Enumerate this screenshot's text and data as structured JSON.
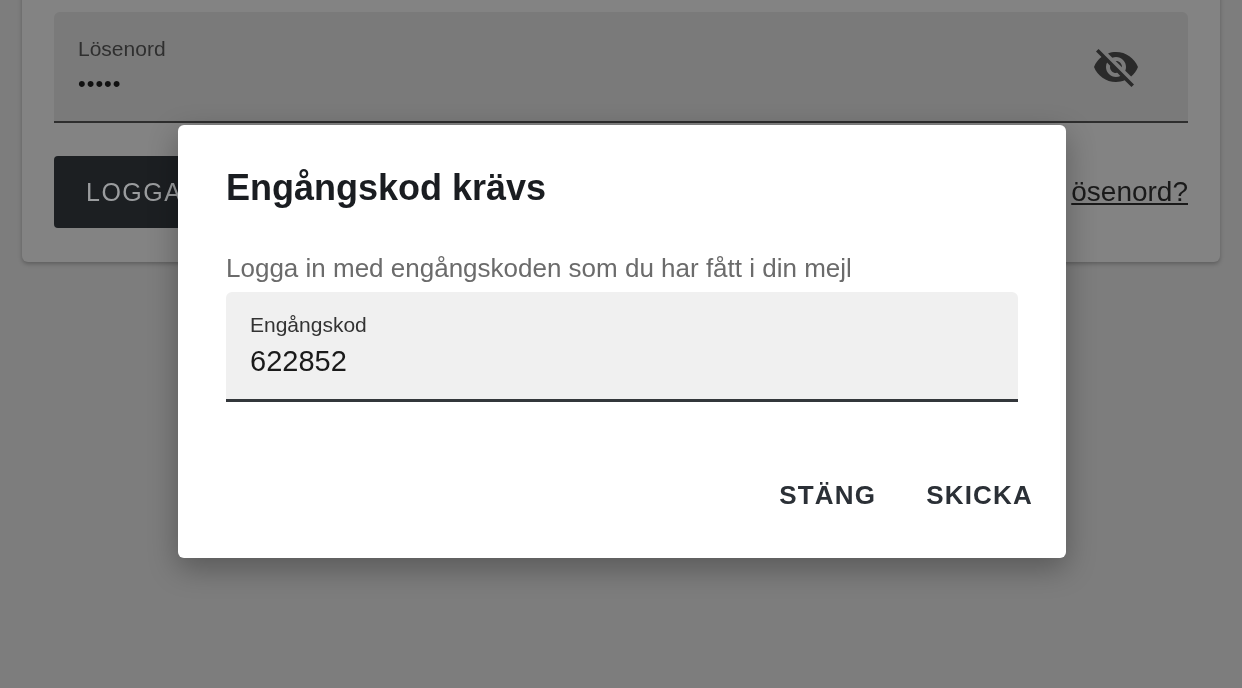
{
  "login_card": {
    "password_field": {
      "label": "Lösenord",
      "value": "•••••"
    },
    "login_button": "LOGGA",
    "forgot_link": "ösenord?"
  },
  "dialog": {
    "title": "Engångskod krävs",
    "message": "Logga in med engångskoden som du har fått i din mejl",
    "field": {
      "label": "Engångskod",
      "value": "622852"
    },
    "buttons": [
      "STÄNG",
      "SKICKA"
    ]
  }
}
